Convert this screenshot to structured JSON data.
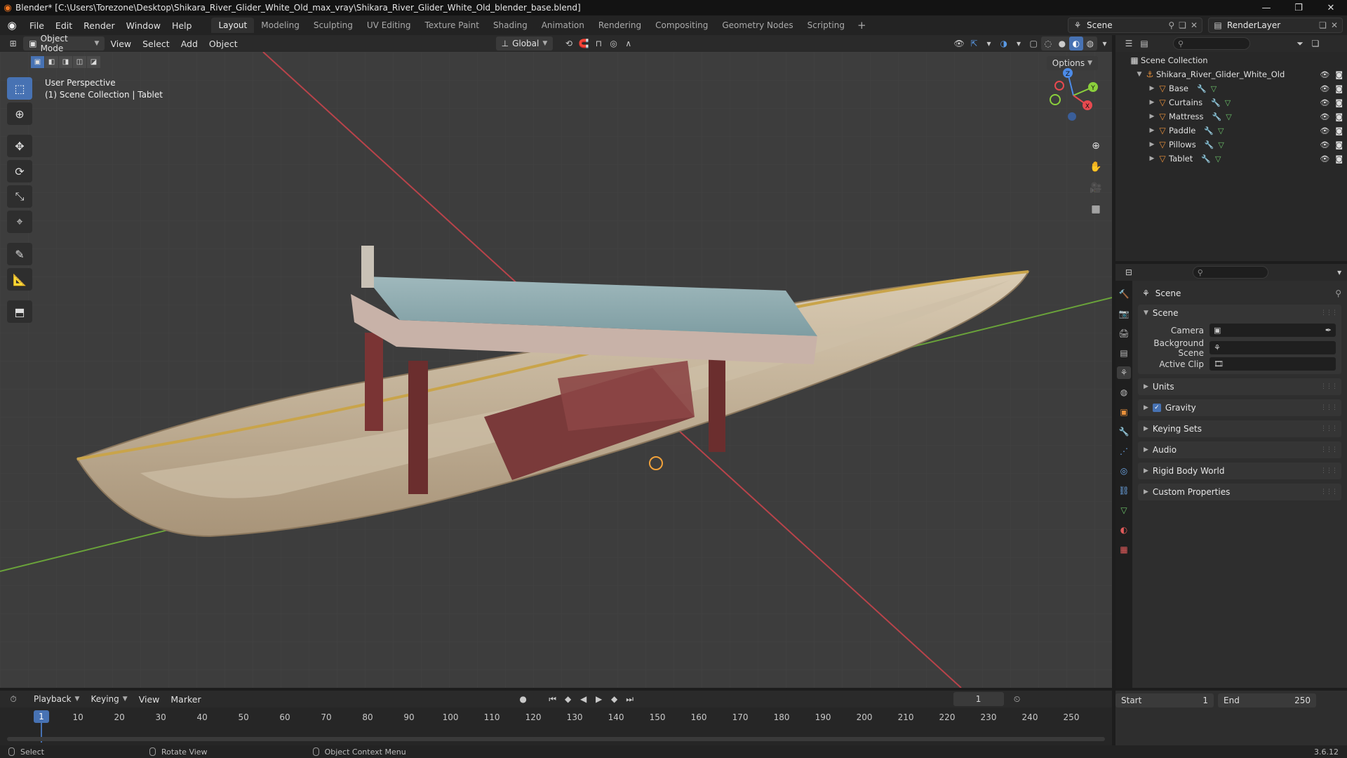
{
  "window": {
    "title": "Blender* [C:\\Users\\Torezone\\Desktop\\Shikara_River_Glider_White_Old_max_vray\\Shikara_River_Glider_White_Old_blender_base.blend]",
    "minimize": "—",
    "restore": "❐",
    "close": "✕"
  },
  "menu": [
    "File",
    "Edit",
    "Render",
    "Window",
    "Help"
  ],
  "workspaces": [
    "Layout",
    "Modeling",
    "Sculpting",
    "UV Editing",
    "Texture Paint",
    "Shading",
    "Animation",
    "Rendering",
    "Compositing",
    "Geometry Nodes",
    "Scripting"
  ],
  "active_workspace": "Layout",
  "scene_selector": {
    "name": "Scene"
  },
  "view_layer_selector": {
    "name": "RenderLayer"
  },
  "viewport_header": {
    "mode": "Object Mode",
    "menus": [
      "View",
      "Select",
      "Add",
      "Object"
    ],
    "transform_orientation": "Global",
    "options": "Options"
  },
  "viewport": {
    "perspective": "User Perspective",
    "collection_info": "(1) Scene Collection | Tablet",
    "gizmo": {
      "x": "X",
      "y": "Y",
      "z": "Z"
    }
  },
  "outliner": {
    "search_placeholder": "",
    "root": "Scene Collection",
    "collection": "Shikara_River_Glider_White_Old",
    "objects": [
      "Base",
      "Curtains",
      "Mattress",
      "Paddle",
      "Pillows",
      "Tablet"
    ]
  },
  "properties": {
    "context": "Scene",
    "scene_panel": {
      "title": "Scene",
      "camera_label": "Camera",
      "background_scene_label": "Background Scene",
      "active_clip_label": "Active Clip"
    },
    "panels": [
      "Units",
      "Gravity",
      "Keying Sets",
      "Audio",
      "Rigid Body World",
      "Custom Properties"
    ],
    "gravity_enabled": true
  },
  "timeline": {
    "menus": [
      "Playback",
      "Keying",
      "View",
      "Marker"
    ],
    "current_frame": "1",
    "start_label": "Start",
    "start": "1",
    "end_label": "End",
    "end": "250",
    "ticks": [
      "10",
      "20",
      "30",
      "40",
      "50",
      "60",
      "70",
      "80",
      "90",
      "100",
      "110",
      "120",
      "130",
      "140",
      "150",
      "160",
      "170",
      "180",
      "190",
      "200",
      "210",
      "220",
      "230",
      "240",
      "250"
    ]
  },
  "statusbar": {
    "select": "Select",
    "rotate": "Rotate View",
    "context_menu": "Object Context Menu",
    "version": "3.6.12"
  },
  "colors": {
    "accent": "#4772b3",
    "x_axis": "#e8494f",
    "y_axis": "#8bd03c",
    "z_axis": "#4c8be8",
    "object_orange": "#e8903a"
  }
}
